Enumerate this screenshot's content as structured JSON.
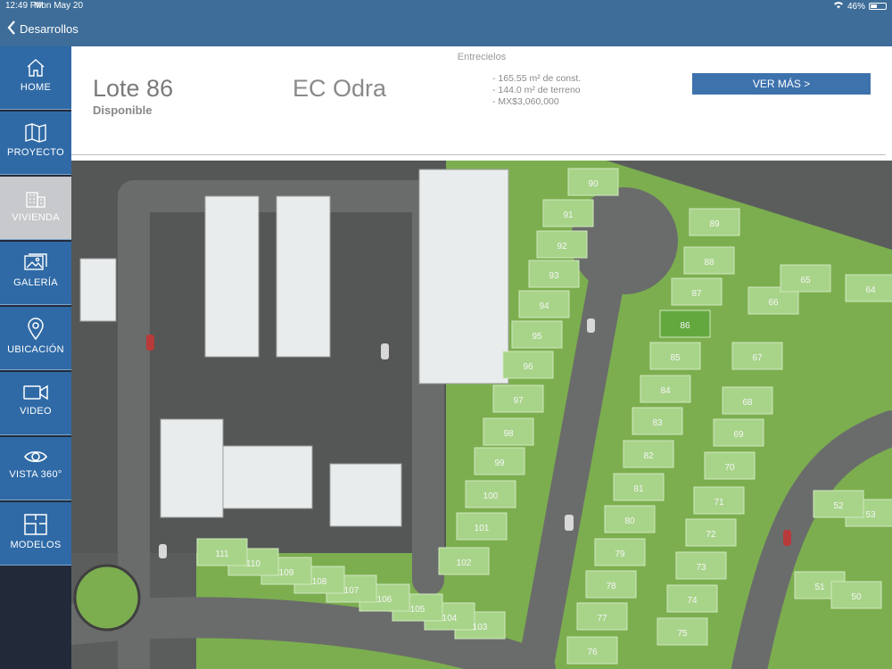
{
  "status_bar": {
    "time": "12:49 PM",
    "date": "Mon May 20",
    "battery_text": "46%",
    "battery_level": 0.46
  },
  "nav": {
    "back_label": "Desarrollos"
  },
  "sidebar": {
    "items": [
      {
        "label": "HOME",
        "icon": "home-icon"
      },
      {
        "label": "PROYECTO",
        "icon": "map-icon"
      },
      {
        "label": "VIVIENDA",
        "icon": "building-icon",
        "active": true
      },
      {
        "label": "GALERÍA",
        "icon": "gallery-icon"
      },
      {
        "label": "UBICACIÓN",
        "icon": "location-pin-icon"
      },
      {
        "label": "VIDEO",
        "icon": "video-camera-icon"
      },
      {
        "label": "VISTA 360°",
        "icon": "eye-icon"
      },
      {
        "label": "MODELOS",
        "icon": "floorplan-icon"
      }
    ]
  },
  "header": {
    "development": "Entrecielos",
    "lot": "Lote 86",
    "status": "Disponible",
    "model": "EC Odra",
    "specs": [
      "- 165.55 m² de const.",
      "- 144.0 m² de terreno",
      "- MX$3,060,000"
    ],
    "cta": "VER MÁS >"
  },
  "map": {
    "lots": [
      "90",
      "91",
      "92",
      "93",
      "94",
      "95",
      "96",
      "97",
      "98",
      "99",
      "100",
      "101",
      "102",
      "103",
      "104",
      "105",
      "106",
      "107",
      "108",
      "109",
      "110",
      "111",
      "89",
      "88",
      "87",
      "86",
      "85",
      "84",
      "83",
      "82",
      "81",
      "80",
      "79",
      "78",
      "77",
      "76",
      "75",
      "74",
      "73",
      "72",
      "71",
      "70",
      "69",
      "68",
      "67",
      "66",
      "65",
      "64",
      "53",
      "52",
      "51",
      "50"
    ],
    "highlighted_lot": "86"
  }
}
